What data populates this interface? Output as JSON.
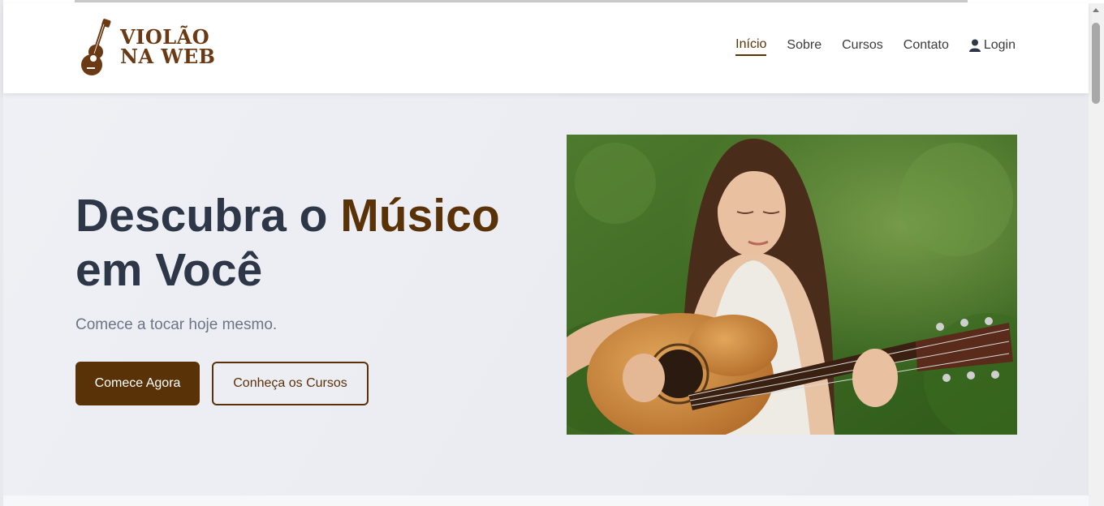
{
  "logo": {
    "line1": "VIOLÃO",
    "line2": "NA WEB"
  },
  "nav": {
    "items": [
      {
        "label": "Início",
        "active": true
      },
      {
        "label": "Sobre"
      },
      {
        "label": "Cursos"
      },
      {
        "label": "Contato"
      }
    ],
    "login": {
      "label": "Login",
      "icon": "user-icon"
    }
  },
  "hero": {
    "title_part1": "Descubra o ",
    "title_accent": "Músico",
    "title_part2": " em Você",
    "subtitle": "Comece a tocar hoje mesmo.",
    "primary_button": "Comece Agora",
    "secondary_button": "Conheça os Cursos"
  },
  "colors": {
    "brand": "#5a3208",
    "logo": "#6b3a14",
    "heading": "#2d3748",
    "subtitle": "#6b7585"
  }
}
